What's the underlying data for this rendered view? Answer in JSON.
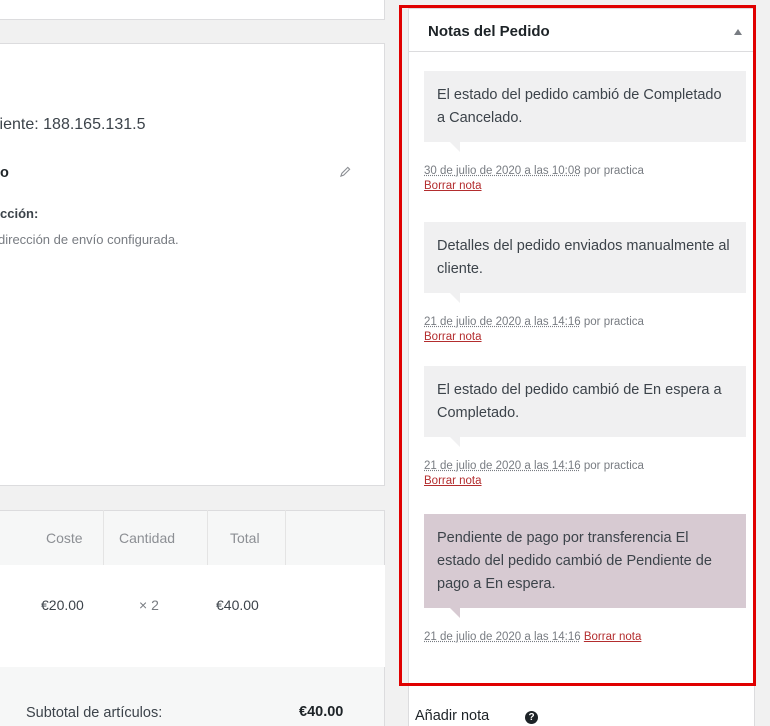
{
  "customer": {
    "ip_text": "liente: 188.165.131.5",
    "shipping_heading": "o",
    "address_label": "cción:",
    "address_value": "dirección de envío configurada."
  },
  "items": {
    "headers": {
      "cost": "Coste",
      "qty": "Cantidad",
      "total": "Total"
    },
    "row": {
      "cost": "€20.00",
      "qty": "× 2",
      "total": "€40.00"
    },
    "subtotal_label": "Subtotal de artículos:",
    "subtotal_value": "€40.00"
  },
  "notes": {
    "title": "Notas del Pedido",
    "delete_label": "Borrar nota",
    "by_prefix": "por",
    "list": [
      {
        "text": "El estado del pedido cambió de Completado a Cancelado.",
        "date": "30 de julio de 2020 a las 10:08",
        "author": "practica"
      },
      {
        "text": "Detalles del pedido enviados manualmente al cliente.",
        "date": "21 de julio de 2020 a las 14:16",
        "author": "practica"
      },
      {
        "text": "El estado del pedido cambió de En espera a Completado.",
        "date": "21 de julio de 2020 a las 14:16",
        "author": "practica"
      },
      {
        "text": "Pendiente de pago por transferencia El estado del pedido cambió de Pendiente de pago a En espera.",
        "date": "21 de julio de 2020 a las 14:16",
        "author": ""
      }
    ],
    "add_note_label": "Añadir nota",
    "help_glyph": "?"
  },
  "colors": {
    "highlight": "#e00000",
    "customer_note_bg": "#d7cad2",
    "system_note_bg": "#f0f0f1",
    "delete_link": "#b32d2e"
  }
}
